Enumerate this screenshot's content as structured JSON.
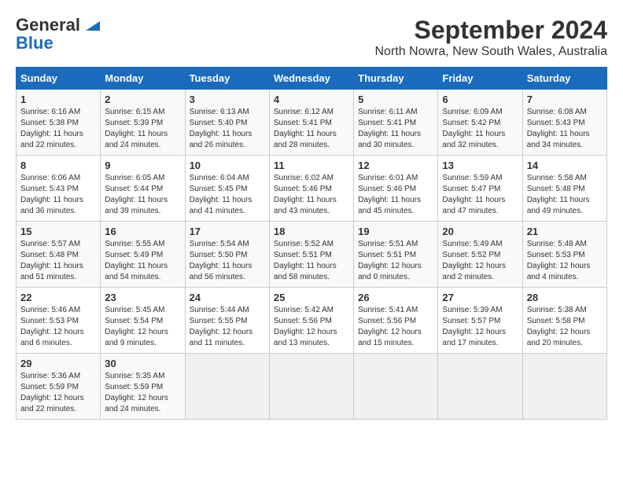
{
  "header": {
    "logo_line1": "General",
    "logo_line2": "Blue",
    "title": "September 2024",
    "subtitle": "North Nowra, New South Wales, Australia"
  },
  "calendar": {
    "days_of_week": [
      "Sunday",
      "Monday",
      "Tuesday",
      "Wednesday",
      "Thursday",
      "Friday",
      "Saturday"
    ],
    "weeks": [
      [
        {
          "day": "",
          "info": ""
        },
        {
          "day": "2",
          "info": "Sunrise: 6:15 AM\nSunset: 5:39 PM\nDaylight: 11 hours\nand 24 minutes."
        },
        {
          "day": "3",
          "info": "Sunrise: 6:13 AM\nSunset: 5:40 PM\nDaylight: 11 hours\nand 26 minutes."
        },
        {
          "day": "4",
          "info": "Sunrise: 6:12 AM\nSunset: 5:41 PM\nDaylight: 11 hours\nand 28 minutes."
        },
        {
          "day": "5",
          "info": "Sunrise: 6:11 AM\nSunset: 5:41 PM\nDaylight: 11 hours\nand 30 minutes."
        },
        {
          "day": "6",
          "info": "Sunrise: 6:09 AM\nSunset: 5:42 PM\nDaylight: 11 hours\nand 32 minutes."
        },
        {
          "day": "7",
          "info": "Sunrise: 6:08 AM\nSunset: 5:43 PM\nDaylight: 11 hours\nand 34 minutes."
        }
      ],
      [
        {
          "day": "8",
          "info": "Sunrise: 6:06 AM\nSunset: 5:43 PM\nDaylight: 11 hours\nand 36 minutes."
        },
        {
          "day": "9",
          "info": "Sunrise: 6:05 AM\nSunset: 5:44 PM\nDaylight: 11 hours\nand 39 minutes."
        },
        {
          "day": "10",
          "info": "Sunrise: 6:04 AM\nSunset: 5:45 PM\nDaylight: 11 hours\nand 41 minutes."
        },
        {
          "day": "11",
          "info": "Sunrise: 6:02 AM\nSunset: 5:46 PM\nDaylight: 11 hours\nand 43 minutes."
        },
        {
          "day": "12",
          "info": "Sunrise: 6:01 AM\nSunset: 5:46 PM\nDaylight: 11 hours\nand 45 minutes."
        },
        {
          "day": "13",
          "info": "Sunrise: 5:59 AM\nSunset: 5:47 PM\nDaylight: 11 hours\nand 47 minutes."
        },
        {
          "day": "14",
          "info": "Sunrise: 5:58 AM\nSunset: 5:48 PM\nDaylight: 11 hours\nand 49 minutes."
        }
      ],
      [
        {
          "day": "15",
          "info": "Sunrise: 5:57 AM\nSunset: 5:48 PM\nDaylight: 11 hours\nand 51 minutes."
        },
        {
          "day": "16",
          "info": "Sunrise: 5:55 AM\nSunset: 5:49 PM\nDaylight: 11 hours\nand 54 minutes."
        },
        {
          "day": "17",
          "info": "Sunrise: 5:54 AM\nSunset: 5:50 PM\nDaylight: 11 hours\nand 56 minutes."
        },
        {
          "day": "18",
          "info": "Sunrise: 5:52 AM\nSunset: 5:51 PM\nDaylight: 11 hours\nand 58 minutes."
        },
        {
          "day": "19",
          "info": "Sunrise: 5:51 AM\nSunset: 5:51 PM\nDaylight: 12 hours\nand 0 minutes."
        },
        {
          "day": "20",
          "info": "Sunrise: 5:49 AM\nSunset: 5:52 PM\nDaylight: 12 hours\nand 2 minutes."
        },
        {
          "day": "21",
          "info": "Sunrise: 5:48 AM\nSunset: 5:53 PM\nDaylight: 12 hours\nand 4 minutes."
        }
      ],
      [
        {
          "day": "22",
          "info": "Sunrise: 5:46 AM\nSunset: 5:53 PM\nDaylight: 12 hours\nand 6 minutes."
        },
        {
          "day": "23",
          "info": "Sunrise: 5:45 AM\nSunset: 5:54 PM\nDaylight: 12 hours\nand 9 minutes."
        },
        {
          "day": "24",
          "info": "Sunrise: 5:44 AM\nSunset: 5:55 PM\nDaylight: 12 hours\nand 11 minutes."
        },
        {
          "day": "25",
          "info": "Sunrise: 5:42 AM\nSunset: 5:56 PM\nDaylight: 12 hours\nand 13 minutes."
        },
        {
          "day": "26",
          "info": "Sunrise: 5:41 AM\nSunset: 5:56 PM\nDaylight: 12 hours\nand 15 minutes."
        },
        {
          "day": "27",
          "info": "Sunrise: 5:39 AM\nSunset: 5:57 PM\nDaylight: 12 hours\nand 17 minutes."
        },
        {
          "day": "28",
          "info": "Sunrise: 5:38 AM\nSunset: 5:58 PM\nDaylight: 12 hours\nand 20 minutes."
        }
      ],
      [
        {
          "day": "29",
          "info": "Sunrise: 5:36 AM\nSunset: 5:59 PM\nDaylight: 12 hours\nand 22 minutes."
        },
        {
          "day": "30",
          "info": "Sunrise: 5:35 AM\nSunset: 5:59 PM\nDaylight: 12 hours\nand 24 minutes."
        },
        {
          "day": "",
          "info": ""
        },
        {
          "day": "",
          "info": ""
        },
        {
          "day": "",
          "info": ""
        },
        {
          "day": "",
          "info": ""
        },
        {
          "day": "",
          "info": ""
        }
      ]
    ],
    "week1_sunday": {
      "day": "1",
      "info": "Sunrise: 6:16 AM\nSunset: 5:38 PM\nDaylight: 11 hours\nand 22 minutes."
    }
  }
}
